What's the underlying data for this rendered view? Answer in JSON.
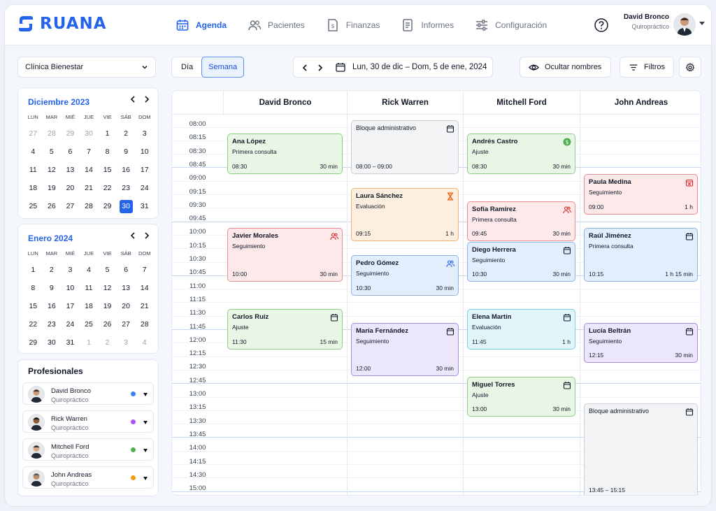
{
  "brand": {
    "name": "RUANA",
    "color": "#2563eb"
  },
  "nav": [
    {
      "label": "Agenda",
      "icon": "calendar-icon",
      "active": true
    },
    {
      "label": "Pacientes",
      "icon": "users-icon"
    },
    {
      "label": "Finanzas",
      "icon": "invoice-icon"
    },
    {
      "label": "Informes",
      "icon": "report-icon"
    },
    {
      "label": "Configuración",
      "icon": "sliders-icon"
    }
  ],
  "user": {
    "name": "David Bronco",
    "role": "Quiropráctico"
  },
  "clinic": {
    "selected": "Clínica Bienestar"
  },
  "mini_calendars": [
    {
      "title": "Diciembre 2023",
      "dows": [
        "LUN",
        "MAR",
        "MIÉ",
        "JUE",
        "VIE",
        "SÁB",
        "DOM"
      ],
      "days": [
        "27",
        "28",
        "29",
        "30",
        "1",
        "2",
        "3",
        "4",
        "5",
        "6",
        "7",
        "8",
        "9",
        "10",
        "11",
        "12",
        "13",
        "14",
        "15",
        "16",
        "17",
        "18",
        "19",
        "20",
        "21",
        "22",
        "23",
        "24",
        "25",
        "26",
        "27",
        "28",
        "29",
        "30",
        "31"
      ],
      "muted": [
        0,
        1,
        2,
        3
      ],
      "selected": 33
    },
    {
      "title": "Enero 2024",
      "dows": [
        "LUN",
        "MAR",
        "MIÉ",
        "JUE",
        "VIE",
        "SÁB",
        "DOM"
      ],
      "days": [
        "1",
        "2",
        "3",
        "4",
        "5",
        "6",
        "7",
        "8",
        "9",
        "10",
        "11",
        "12",
        "13",
        "14",
        "15",
        "16",
        "17",
        "18",
        "19",
        "20",
        "21",
        "22",
        "23",
        "24",
        "25",
        "26",
        "27",
        "28",
        "29",
        "30",
        "31",
        "1",
        "2",
        "3",
        "4"
      ],
      "muted": [
        31,
        32,
        33,
        34
      ],
      "selected": -1
    }
  ],
  "professionals": {
    "title": "Profesionales",
    "items": [
      {
        "name": "David Bronco",
        "role": "Quiropráctico",
        "color": "#3b82f6"
      },
      {
        "name": "Rick Warren",
        "role": "Quiropráctico",
        "color": "#a855f7"
      },
      {
        "name": "Mitchell Ford",
        "role": "Quiropráctico",
        "color": "#4caf50"
      },
      {
        "name": "John Andreas",
        "role": "Quiropráctico",
        "color": "#f59e0b"
      }
    ]
  },
  "toolbar": {
    "view_day": "Día",
    "view_week": "Semana",
    "range": "Lun, 30 de dic – Dom, 5 de ene, 2024",
    "hide_names": "Ocultar nombres",
    "filters": "Filtros"
  },
  "calendar": {
    "columns": [
      "David Bronco",
      "Rick Warren",
      "Mitchell Ford",
      "John Andreas"
    ],
    "times": [
      "08:00",
      "08:15",
      "08:30",
      "08:45",
      "09:00",
      "09:15",
      "09:30",
      "09:45",
      "10:00",
      "10:15",
      "10:30",
      "10:45",
      "11:00",
      "11:15",
      "11:30",
      "11:45",
      "12:00",
      "12:15",
      "12:30",
      "12:45",
      "13:00",
      "13:15",
      "13:30",
      "13:45",
      "14:00",
      "14:15",
      "14:30",
      "15:00"
    ],
    "appointments": [
      {
        "col": 0,
        "start": "08:15",
        "end": "08:45",
        "name": "Ana López",
        "type": "Primera consulta",
        "time": "08:30",
        "duration": "30 min",
        "color": "green"
      },
      {
        "col": 0,
        "start": "10:00",
        "end": "10:45",
        "name": "Javier Morales",
        "type": "Seguimiento",
        "time": "10:00",
        "duration": "30 min",
        "color": "red",
        "icon": "users-icon"
      },
      {
        "col": 0,
        "start": "11:30",
        "end": "12:00",
        "name": "Carlos Ruiz",
        "type": "Ajuste",
        "time": "11:30",
        "duration": "15 min",
        "color": "green",
        "icon": "calendar-icon"
      },
      {
        "col": 1,
        "start": "08:00",
        "end": "08:45",
        "name": "Bloque administrativo",
        "type": "",
        "time": "08:00 – 09:00",
        "duration": "",
        "color": "gray",
        "icon": "calendar-icon",
        "block": true
      },
      {
        "col": 1,
        "start": "09:15",
        "end": "10:00",
        "name": "Laura Sánchez",
        "type": "Evaluación",
        "time": "09:15",
        "duration": "1 h",
        "color": "orange",
        "icon": "hourglass-icon"
      },
      {
        "col": 1,
        "start": "10:30",
        "end": "11:00",
        "name": "Pedro Gómez",
        "type": "Seguimiento",
        "time": "10:30",
        "duration": "30 min",
        "color": "blue",
        "icon": "users-icon"
      },
      {
        "col": 1,
        "start": "11:45",
        "end": "12:30",
        "name": "María Fernández",
        "type": "Seguimiento",
        "time": "12:00",
        "duration": "30 min",
        "color": "purple",
        "icon": "calendar-icon"
      },
      {
        "col": 2,
        "start": "08:15",
        "end": "08:45",
        "name": "Andrés Castro",
        "type": "Ajuste",
        "time": "08:30",
        "duration": "30 min",
        "color": "green",
        "icon": "dollar-icon"
      },
      {
        "col": 2,
        "start": "09:30",
        "end": "10:00",
        "name": "Sofía Ramírez",
        "type": "Primera consulta",
        "time": "09:45",
        "duration": "30 min",
        "color": "red",
        "icon": "users-icon"
      },
      {
        "col": 2,
        "start": "10:15",
        "end": "10:45",
        "name": "Diego Herrera",
        "type": "Seguimiento",
        "time": "10:30",
        "duration": "30 min",
        "color": "blue",
        "icon": "calendar-icon"
      },
      {
        "col": 2,
        "start": "11:30",
        "end": "12:00",
        "name": "Elena Martín",
        "type": "Evaluación",
        "time": "11:45",
        "duration": "1 h",
        "color": "cyan",
        "icon": "calendar-icon"
      },
      {
        "col": 2,
        "start": "12:45",
        "end": "13:15",
        "name": "Miguel Torres",
        "type": "Ajuste",
        "time": "13:00",
        "duration": "30 min",
        "color": "green",
        "icon": "calendar-icon"
      },
      {
        "col": 3,
        "start": "09:00",
        "end": "09:30",
        "name": "Paula Medina",
        "type": "Seguimiento",
        "time": "09:00",
        "duration": "1 h",
        "color": "red",
        "icon": "calendar-x-icon"
      },
      {
        "col": 3,
        "start": "10:00",
        "end": "10:45",
        "name": "Raúl Jiménez",
        "type": "Primera consulta",
        "time": "10:15",
        "duration": "1 h 15 min",
        "color": "blue",
        "icon": "calendar-icon"
      },
      {
        "col": 3,
        "start": "11:45",
        "end": "12:15",
        "name": "Lucía Beltrán",
        "type": "Seguimiento",
        "time": "12:15",
        "duration": "30 min",
        "color": "purple",
        "icon": "calendar-icon"
      },
      {
        "col": 3,
        "start": "13:15",
        "end": "14:45",
        "name": "Bloque administrativo",
        "type": "",
        "time": "13:45 – 15:15",
        "duration": "",
        "color": "gray",
        "icon": "calendar-icon",
        "block": true
      }
    ]
  }
}
